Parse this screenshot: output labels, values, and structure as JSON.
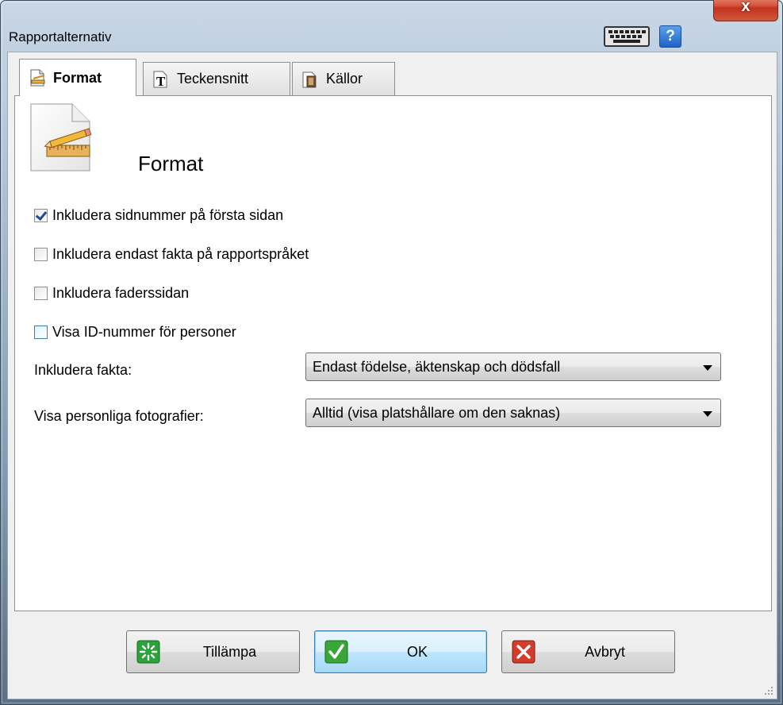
{
  "window": {
    "title": "Rapportalternativ",
    "help_label": "?",
    "close_label": "x"
  },
  "tabs": [
    {
      "label": "Format",
      "active": true
    },
    {
      "label": "Teckensnitt",
      "active": false
    },
    {
      "label": "Källor",
      "active": false
    }
  ],
  "panel": {
    "heading": "Format",
    "checkboxes": [
      {
        "label": "Inkludera sidnummer på första sidan",
        "checked": true
      },
      {
        "label": "Inkludera endast fakta på rapportspråket",
        "checked": false
      },
      {
        "label": "Inkludera faderssidan",
        "checked": false
      },
      {
        "label": "Visa ID-nummer för personer",
        "checked": false
      }
    ],
    "fields": [
      {
        "label": "Inkludera fakta:",
        "value": "Endast födelse, äktenskap och dödsfall"
      },
      {
        "label": "Visa personliga fotografier:",
        "value": "Alltid (visa platshållare om den saknas)"
      }
    ]
  },
  "buttons": {
    "apply": "Tillämpa",
    "ok": "OK",
    "cancel": "Avbryt"
  },
  "colors": {
    "accent": "#3c7fb1",
    "close": "#c2331c",
    "apply_icon": "#2aa33a",
    "ok_icon": "#3aa63a",
    "cancel_icon": "#d33b2a"
  }
}
